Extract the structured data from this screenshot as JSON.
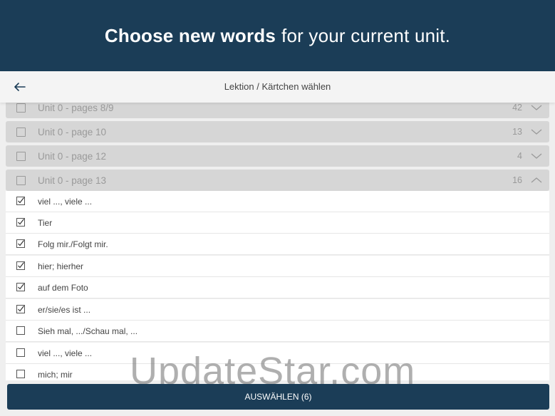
{
  "banner": {
    "bold": "Choose new words",
    "rest": "for your current unit."
  },
  "appbar": {
    "title": "Lektion / Kärtchen wählen"
  },
  "units": [
    {
      "label": "Unit 0 - pages 8/9",
      "count": "42",
      "expanded": false
    },
    {
      "label": "Unit 0 - page 10",
      "count": "13",
      "expanded": false
    },
    {
      "label": "Unit 0 - page 12",
      "count": "4",
      "expanded": false
    },
    {
      "label": "Unit 0 - page 13",
      "count": "16",
      "expanded": true
    }
  ],
  "words": [
    {
      "text": "viel ..., viele ...",
      "checked": true
    },
    {
      "text": "Tier",
      "checked": true
    },
    {
      "text": "Folg mir./Folgt mir.",
      "checked": true
    },
    {
      "text": "hier; hierher",
      "checked": true
    },
    {
      "text": "auf dem Foto",
      "checked": true
    },
    {
      "text": "er/sie/es ist ...",
      "checked": true
    },
    {
      "text": "Sieh mal, .../Schau mal, ...",
      "checked": false
    },
    {
      "text": "viel ..., viele ...",
      "checked": false
    },
    {
      "text": "mich; mir",
      "checked": false
    }
  ],
  "watermark": "UpdateStar.com",
  "select_button": "AUSWÄHLEN (6)",
  "colors": {
    "primary": "#1b3d57",
    "unit_bg": "#d6d6d6",
    "page_bg": "#efefef"
  }
}
